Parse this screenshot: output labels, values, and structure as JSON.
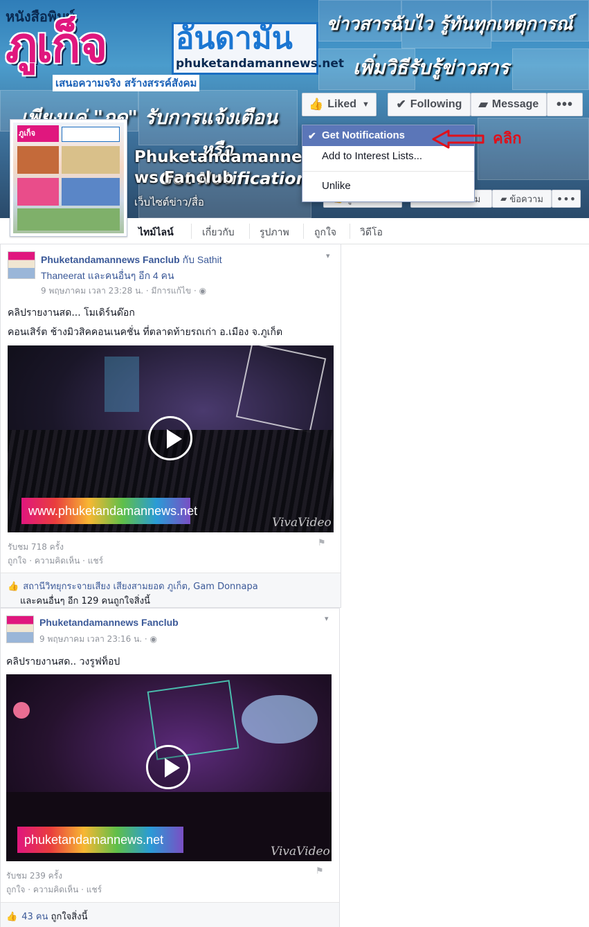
{
  "cover": {
    "brand_small": "หนังสือพิมพ์",
    "brand_big": "ภูเก็จ",
    "brand_andaman": "อันดามัน",
    "brand_url": "phuketandamannews.net",
    "brand_slogan": "เสนอความจริง สร้างสรรค์สังคม",
    "headline1": "ข่าวสารฉับไว รู้ทันทุกเหตุการณ์",
    "headline2": "เพิ่มวิธีรับรู้ข่าวสาร",
    "headline3": "เพียงแค่ \"กด\" รับการแจ้งเตือน",
    "headline4": "หรือ",
    "headline5": "Get Notifications"
  },
  "page": {
    "name": "Phuketandamannews Fanclub",
    "category": "เว็บไซต์ข่าว/สื่อ"
  },
  "actions": {
    "liked": "Liked",
    "following": "Following",
    "message": "Message",
    "more": "•••"
  },
  "dropdown": {
    "items": [
      "Get Notifications",
      "Add to Interest Lists...",
      "Unlike"
    ]
  },
  "annotation": {
    "label": "คลิก",
    "color": "#e0101a"
  },
  "actions_th": {
    "liked": "ถูกใจแล้ว",
    "following": "กำลังติดตาม",
    "message": "ข้อความ",
    "more": "•••"
  },
  "nav": {
    "tabs": [
      "ไทม์ไลน์",
      "เกี่ยวกับ",
      "รูปภาพ",
      "ถูกใจ",
      "วิดีโอ"
    ]
  },
  "posts": [
    {
      "author": "Phuketandamannews Fanclub",
      "with": " กับ Sathit",
      "with2": "Thaneerat และคนอื่นๆ อีก 4 คน",
      "meta": "9 พฤษภาคม เวลา 23:28 น. · มีการแก้ไข · ◉",
      "text1": "คลิปรายงานสด... โมเดิร์นด๊อก",
      "text2": "คอนเสิร์ต ช้างมิวสิคคอนเนคชั่น ที่ตลาดท้ายรถเก่า อ.เมือง จ.ภูเก็ต",
      "banner": "www.phuketandamannews.net",
      "watermark": "VivaVideo",
      "views": "รับชม 718 ครั้ง",
      "actions": "ถูกใจ · ความคิดเห็น · แชร์",
      "likes_names": "สถานีวิทยุกระจายเสียง เสียงสามยอด ภูเก็ต, Gam Donnapa",
      "likes_rest": "และคนอื่นๆ อีก 129 คนถูกใจสิ่งนี้"
    },
    {
      "author": "Phuketandamannews Fanclub",
      "meta": "9 พฤษภาคม เวลา 23:16 น. · ◉",
      "text1": "คลิปรายงานสด.. วงรูฟท็อป",
      "banner": "phuketandamannews.net",
      "watermark": "VivaVideo",
      "views": "รับชม 239 ครั้ง",
      "actions": "ถูกใจ · ความคิดเห็น · แชร์",
      "likes_count": "43 คน",
      "likes_rest": "ถูกใจสิ่งนี้"
    }
  ]
}
